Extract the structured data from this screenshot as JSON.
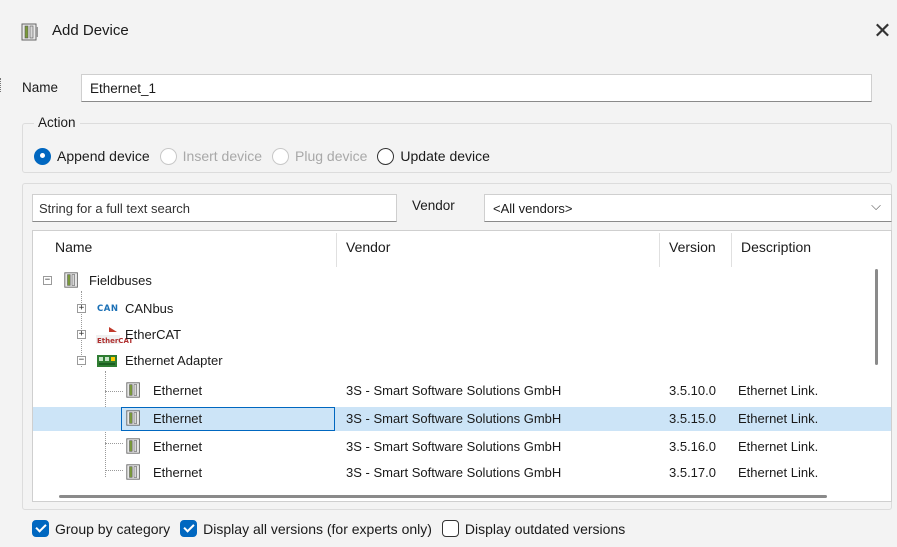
{
  "window": {
    "title": "Add Device",
    "close_glyph": "✕",
    "icon": "device-icon"
  },
  "name_field": {
    "label": "Name",
    "value": "Ethernet_1"
  },
  "action": {
    "legend": "Action",
    "options": [
      {
        "label": "Append device",
        "checked": true,
        "enabled": true
      },
      {
        "label": "Insert device",
        "checked": false,
        "enabled": false
      },
      {
        "label": "Plug device",
        "checked": false,
        "enabled": false
      },
      {
        "label": "Update device",
        "checked": false,
        "enabled": true
      }
    ]
  },
  "search": {
    "placeholder": "String for a full text search"
  },
  "vendor": {
    "label": "Vendor",
    "selected": "<All vendors>"
  },
  "table": {
    "columns": [
      "Name",
      "Vendor",
      "Version",
      "Description"
    ],
    "tree": [
      {
        "label": "Fieldbuses",
        "icon": "device-icon",
        "expander": "−"
      },
      {
        "label": "CANbus",
        "icon": "can-icon",
        "expander": "+"
      },
      {
        "label": "EtherCAT",
        "icon": "ethercat-icon",
        "expander": "+"
      },
      {
        "label": "Ethernet Adapter",
        "icon": "ethernet-adapter-icon",
        "expander": "−"
      }
    ],
    "rows": [
      {
        "name": "Ethernet",
        "vendor": "3S - Smart Software Solutions GmbH",
        "version": "3.5.10.0",
        "description": "Ethernet Link.",
        "selected": false
      },
      {
        "name": "Ethernet",
        "vendor": "3S - Smart Software Solutions GmbH",
        "version": "3.5.15.0",
        "description": "Ethernet Link.",
        "selected": true
      },
      {
        "name": "Ethernet",
        "vendor": "3S - Smart Software Solutions GmbH",
        "version": "3.5.16.0",
        "description": "Ethernet Link.",
        "selected": false
      },
      {
        "name": "Ethernet",
        "vendor": "3S - Smart Software Solutions GmbH",
        "version": "3.5.17.0",
        "description": "Ethernet Link.",
        "selected": false
      }
    ],
    "can_icon_text": "CAN",
    "ethercat_icon_text": "EtherCAT"
  },
  "options": {
    "group_by_category": {
      "label": "Group by category",
      "checked": true
    },
    "display_all_versions": {
      "label": "Display all versions (for experts only)",
      "checked": true
    },
    "display_outdated": {
      "label": "Display outdated versions",
      "checked": false
    }
  },
  "colors": {
    "accent": "#0067c0",
    "selection": "#cce4f7"
  }
}
